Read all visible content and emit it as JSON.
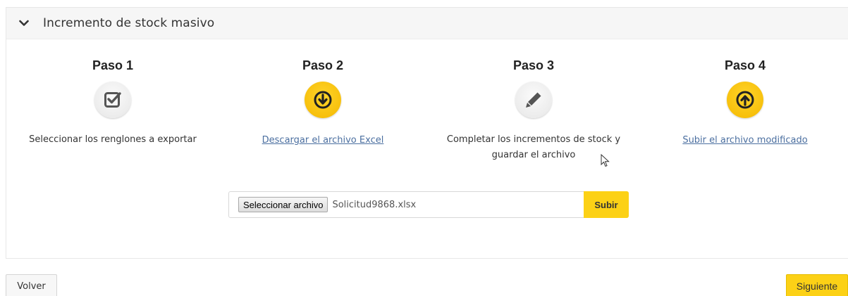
{
  "panel": {
    "title": "Incremento de stock masivo"
  },
  "steps": [
    {
      "title": "Paso 1",
      "icon": "checkbox-check-icon",
      "text": "Seleccionar los renglones a exportar"
    },
    {
      "title": "Paso 2",
      "icon": "download-arrow-icon",
      "link": "Descargar el archivo Excel"
    },
    {
      "title": "Paso 3",
      "icon": "pencil-icon",
      "text_line1": "Completar los incrementos de stock y",
      "text_line2": "guardar el archivo"
    },
    {
      "title": "Paso 4",
      "icon": "upload-arrow-icon",
      "link": "Subir el archivo modificado"
    }
  ],
  "upload": {
    "select_label": "Seleccionar archivo",
    "file_name": "Solicitud9868.xlsx",
    "submit_label": "Subir"
  },
  "footer": {
    "back_label": "Volver",
    "next_label": "Siguiente"
  },
  "colors": {
    "accent_yellow": "#fcd116",
    "link_blue": "#4b6fa0"
  }
}
